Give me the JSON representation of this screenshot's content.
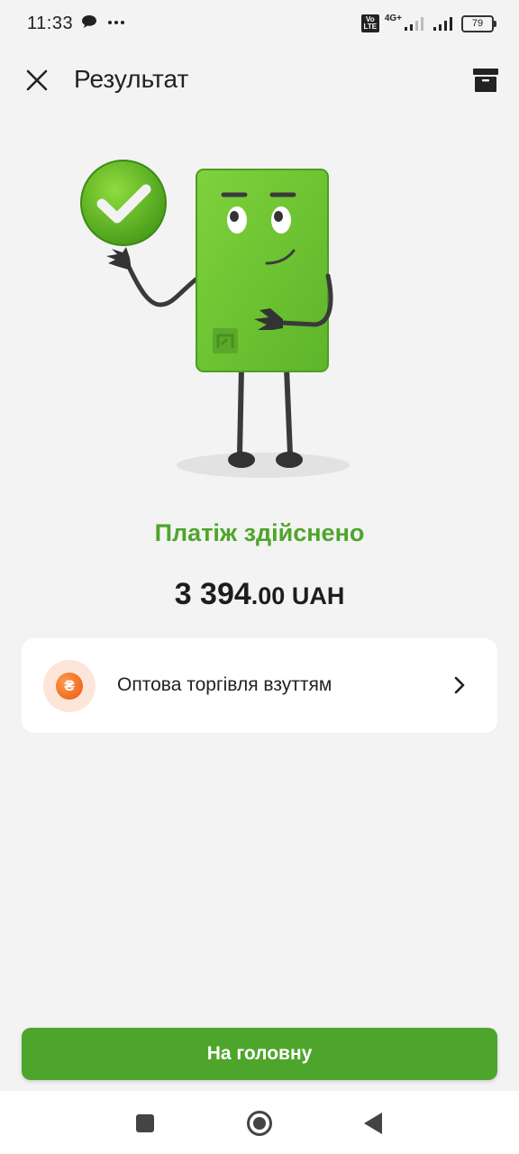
{
  "status_bar": {
    "time": "11:33",
    "network": "4G+",
    "volte": "Vo LTE",
    "battery": "79"
  },
  "header": {
    "title": "Результат"
  },
  "result": {
    "title": "Платіж здійснено",
    "amount_main": "3 394",
    "amount_decimals": ".00 UAH"
  },
  "merchant": {
    "name": "Оптова торгівля взуттям",
    "icon_symbol": "₴"
  },
  "actions": {
    "home_label": "На головну"
  },
  "colors": {
    "accent_green": "#4ea52b",
    "card_green": "#74c639",
    "merchant_orange": "#e8590f"
  }
}
